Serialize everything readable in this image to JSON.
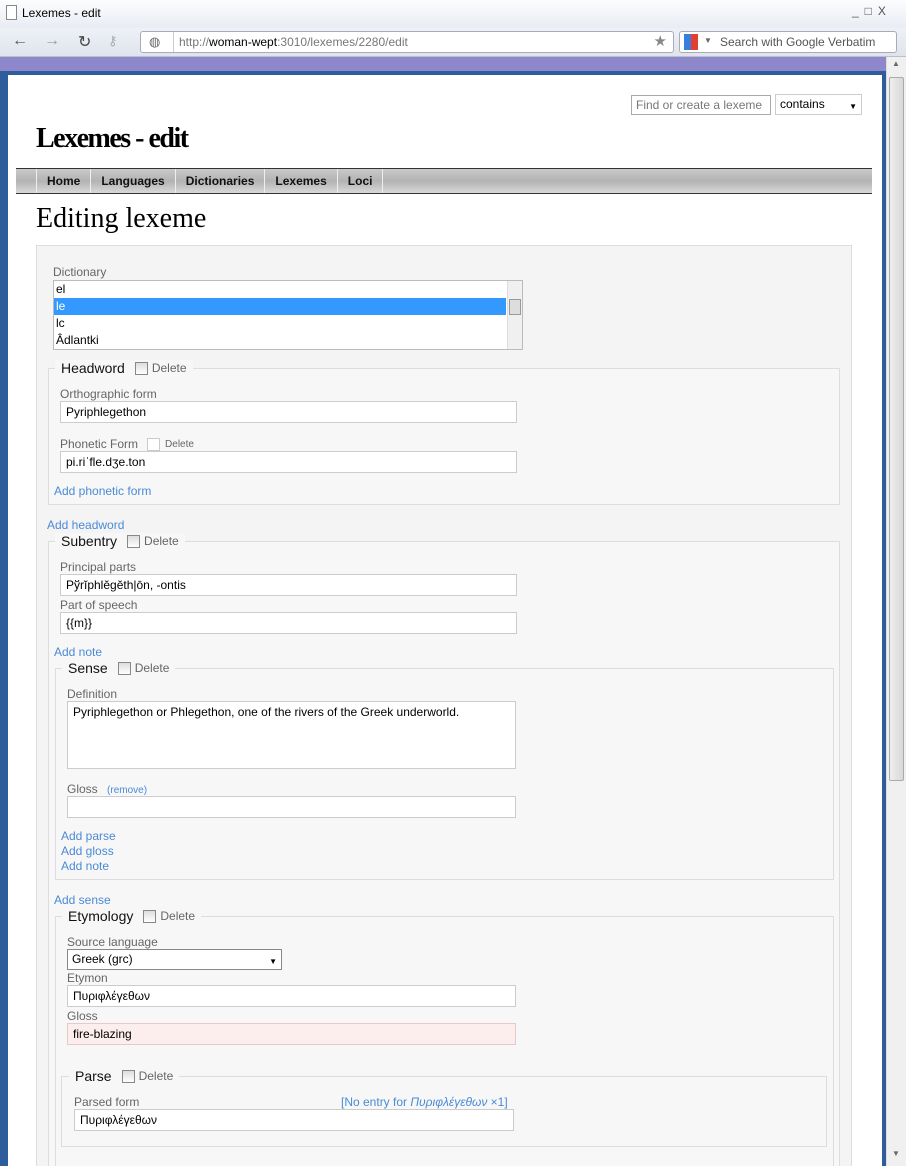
{
  "browser": {
    "tab_title": "Lexemes - edit",
    "url_prefix": "http://",
    "url_host": "woman-wept",
    "url_rest": ":3010/lexemes/2280/edit",
    "search_placeholder": "Search with Google Verbatim"
  },
  "header": {
    "search_placeholder": "Find or create a lexeme",
    "match_mode": "contains",
    "site_title": "Lexemes - edit"
  },
  "nav": [
    {
      "label": "Home"
    },
    {
      "label": "Languages"
    },
    {
      "label": "Dictionaries"
    },
    {
      "label": "Lexemes"
    },
    {
      "label": "Loci"
    }
  ],
  "page_title": "Editing lexeme",
  "dictionary": {
    "label": "Dictionary",
    "options": [
      "el",
      "le",
      "lc",
      "Âdlantki"
    ],
    "selected": "le"
  },
  "headword": {
    "legend": "Headword",
    "delete": "Delete",
    "ortho_label": "Orthographic form",
    "ortho_value": "Pyriphlegethon",
    "phon_label": "Phonetic Form",
    "phon_delete": "Delete",
    "phon_value": "pi.riˈfle.dʒe.ton",
    "add_phonetic": "Add phonetic form"
  },
  "add_headword": "Add headword",
  "subentry": {
    "legend": "Subentry",
    "delete": "Delete",
    "pp_label": "Principal parts",
    "pp_value": "Pўrĭphlĕgĕth|ōn, -ontis",
    "pos_label": "Part of speech",
    "pos_value": "{{m}}",
    "add_note": "Add note"
  },
  "sense": {
    "legend": "Sense",
    "delete": "Delete",
    "def_label": "Definition",
    "def_value": "Pyriphlegethon or Phlegethon, one of the rivers of the Greek underworld.",
    "gloss_label": "Gloss",
    "gloss_remove": "(remove)",
    "gloss_value": "",
    "add_parse": "Add parse",
    "add_gloss": "Add gloss",
    "add_note": "Add note"
  },
  "add_sense": "Add sense",
  "etymology": {
    "legend": "Etymology",
    "delete": "Delete",
    "src_label": "Source language",
    "src_value": "Greek (grc)",
    "etymon_label": "Etymon",
    "etymon_value": "Πυριφλέγεθων",
    "gloss_label": "Gloss",
    "gloss_value": "fire-blazing"
  },
  "parse": {
    "legend": "Parse",
    "delete": "Delete",
    "label": "Parsed form",
    "no_entry_prefix": "[No entry for ",
    "no_entry_word": "Πυριφλέγεθων",
    "no_entry_suffix": " ×1]",
    "value": "Πυριφλέγεθων"
  },
  "colors": {
    "link": "#4a8ad6",
    "selected": "#3399ff",
    "error_bg": "#fdeeee"
  }
}
